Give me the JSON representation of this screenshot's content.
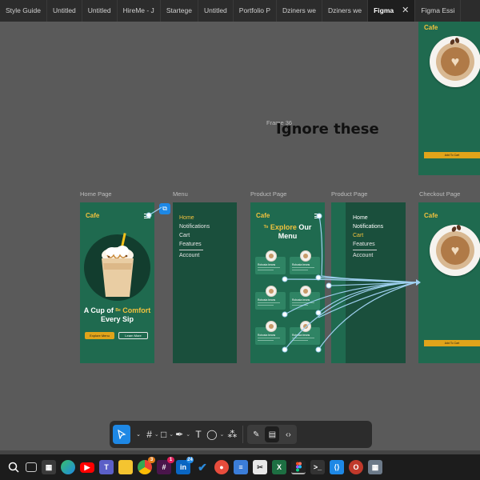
{
  "tabs": [
    {
      "label": "Style Guide"
    },
    {
      "label": "Untitled"
    },
    {
      "label": "Untitled"
    },
    {
      "label": "HireMe - J"
    },
    {
      "label": "Startege"
    },
    {
      "label": "Untitled"
    },
    {
      "label": "Portfolio P"
    },
    {
      "label": "Dziners we"
    },
    {
      "label": "Dziners we"
    },
    {
      "label": "Figma"
    },
    {
      "label": "Figma Essi"
    }
  ],
  "frame_labels": {
    "frame36": "Frame 36",
    "home": "Home Page",
    "menu": "Menu",
    "product1": "Product Page",
    "product2": "Product Page",
    "checkout": "Checkout Page"
  },
  "annotation": "Ignore these",
  "brand": {
    "logo": "Cafe",
    "accent": "#f2c23e",
    "green": "#1f6a4f",
    "dark_green": "#1a4f3c"
  },
  "home": {
    "headline_pre": "A Cup of",
    "headline_small": "Be",
    "headline_highlight": "Comfort",
    "headline_post": "Every Sip",
    "explore_button": "Explore Menu",
    "learn_button": "Learn More"
  },
  "menu": {
    "items": [
      {
        "label": "Home"
      },
      {
        "label": "Notifications"
      },
      {
        "label": "Cart"
      },
      {
        "label": "Features"
      },
      {
        "label": "Account"
      }
    ]
  },
  "product": {
    "title_small": "To",
    "title_highlight": "Explore",
    "title_rest": "Our",
    "title_line2": "Menu",
    "card_names": [
      "Robusta beans",
      "Robusta beans",
      "Robusta beans",
      "Robusta beans",
      "Robusta beans",
      "Robusta beans"
    ]
  },
  "menu2": {
    "items": [
      {
        "label": "Home"
      },
      {
        "label": "Notifications"
      },
      {
        "label": "Cart"
      },
      {
        "label": "Features"
      },
      {
        "label": "Account"
      }
    ]
  },
  "checkout": {
    "add_to_cart": "Add To Cart"
  },
  "top_right": {
    "add_to_cart": "Add To Cart"
  },
  "toolbar": {
    "tools": [
      "move-tool",
      "frame-tool",
      "shape-tool",
      "pen-tool",
      "text-tool",
      "comment-tool",
      "components-tool"
    ],
    "text_glyph": "T"
  },
  "taskbar": {
    "badges": {
      "chrome": "3",
      "slack": "1",
      "linkedin": "24"
    }
  }
}
